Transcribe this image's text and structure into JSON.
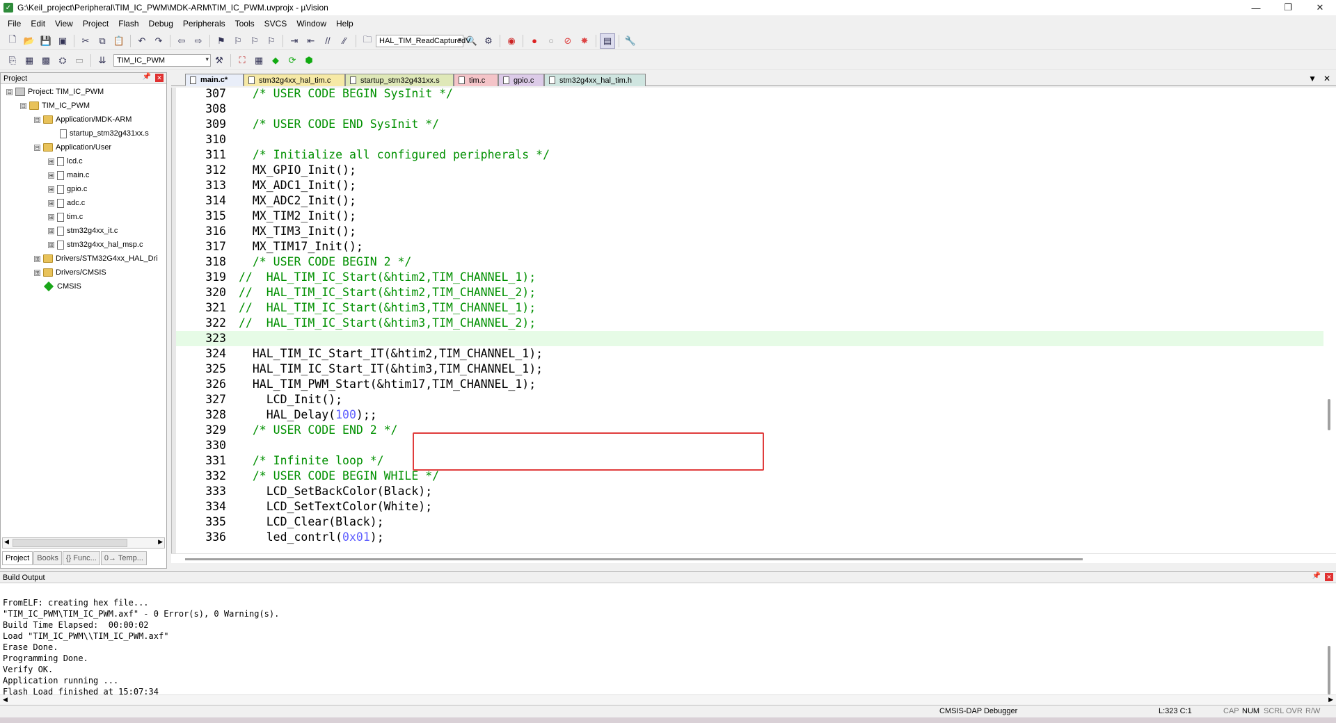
{
  "window": {
    "title": "G:\\Keil_project\\Peripheral\\TIM_IC_PWM\\MDK-ARM\\TIM_IC_PWM.uvprojx - µVision",
    "minimize": "—",
    "maximize": "❐",
    "close": "✕"
  },
  "menu": [
    "File",
    "Edit",
    "View",
    "Project",
    "Flash",
    "Debug",
    "Peripherals",
    "Tools",
    "SVCS",
    "Window",
    "Help"
  ],
  "toolbar": {
    "find_combo": "HAL_TIM_ReadCapturedV",
    "target_combo": "TIM_IC_PWM"
  },
  "project_pane": {
    "title": "Project",
    "tree": [
      {
        "label": "Project: TIM_IC_PWM",
        "icon": "project-icon",
        "expander": "⊟"
      },
      {
        "label": "TIM_IC_PWM",
        "icon": "folder-icon",
        "expander": "⊟"
      },
      {
        "label": "Application/MDK-ARM",
        "icon": "folder-icon",
        "expander": "⊟"
      },
      {
        "label": "startup_stm32g431xx.s",
        "icon": "file-icon",
        "expander": ""
      },
      {
        "label": "Application/User",
        "icon": "folder-icon",
        "expander": "⊟"
      },
      {
        "label": "lcd.c",
        "icon": "file-icon",
        "expander": "⊞"
      },
      {
        "label": "main.c",
        "icon": "file-icon",
        "expander": "⊞"
      },
      {
        "label": "gpio.c",
        "icon": "file-icon",
        "expander": "⊞"
      },
      {
        "label": "adc.c",
        "icon": "file-icon",
        "expander": "⊞"
      },
      {
        "label": "tim.c",
        "icon": "file-icon",
        "expander": "⊞"
      },
      {
        "label": "stm32g4xx_it.c",
        "icon": "file-icon",
        "expander": "⊞"
      },
      {
        "label": "stm32g4xx_hal_msp.c",
        "icon": "file-icon",
        "expander": "⊞"
      },
      {
        "label": "Drivers/STM32G4xx_HAL_Dri",
        "icon": "folder-icon",
        "expander": "⊞"
      },
      {
        "label": "Drivers/CMSIS",
        "icon": "folder-icon",
        "expander": "⊞"
      },
      {
        "label": "CMSIS",
        "icon": "diamond-icon",
        "expander": ""
      }
    ],
    "tabs": [
      "Project",
      "Books",
      "{} Func...",
      "0→ Temp..."
    ]
  },
  "file_tabs": [
    {
      "label": "main.c*",
      "color": "#e9eef9"
    },
    {
      "label": "stm32g4xx_hal_tim.c",
      "color": "#f6e9a6"
    },
    {
      "label": "startup_stm32g431xx.s",
      "color": "#dfe8b8"
    },
    {
      "label": "tim.c",
      "color": "#f4c4c8"
    },
    {
      "label": "gpio.c",
      "color": "#dccbe8"
    },
    {
      "label": "stm32g4xx_hal_tim.h",
      "color": "#cfe5e0"
    }
  ],
  "code": [
    {
      "n": "307",
      "t": "  /* USER CODE BEGIN SysInit */",
      "k": "cm"
    },
    {
      "n": "308",
      "t": "",
      "k": ""
    },
    {
      "n": "309",
      "t": "  /* USER CODE END SysInit */",
      "k": "cm"
    },
    {
      "n": "310",
      "t": "",
      "k": ""
    },
    {
      "n": "311",
      "t": "  /* Initialize all configured peripherals */",
      "k": "cm"
    },
    {
      "n": "312",
      "t": "  MX_GPIO_Init();",
      "k": ""
    },
    {
      "n": "313",
      "t": "  MX_ADC1_Init();",
      "k": ""
    },
    {
      "n": "314",
      "t": "  MX_ADC2_Init();",
      "k": ""
    },
    {
      "n": "315",
      "t": "  MX_TIM2_Init();",
      "k": ""
    },
    {
      "n": "316",
      "t": "  MX_TIM3_Init();",
      "k": ""
    },
    {
      "n": "317",
      "t": "  MX_TIM17_Init();",
      "k": ""
    },
    {
      "n": "318",
      "t": "  /* USER CODE BEGIN 2 */",
      "k": "cm"
    },
    {
      "n": "319",
      "t": "//  HAL_TIM_IC_Start(&htim2,TIM_CHANNEL_1);",
      "k": "cm"
    },
    {
      "n": "320",
      "t": "//  HAL_TIM_IC_Start(&htim2,TIM_CHANNEL_2);",
      "k": "cm"
    },
    {
      "n": "321",
      "t": "//  HAL_TIM_IC_Start(&htim3,TIM_CHANNEL_1);",
      "k": "cm"
    },
    {
      "n": "322",
      "t": "//  HAL_TIM_IC_Start(&htim3,TIM_CHANNEL_2);",
      "k": "cm"
    },
    {
      "n": "323",
      "t": "",
      "k": "cur"
    },
    {
      "n": "324",
      "t": "  HAL_TIM_IC_Start_IT(&htim2,TIM_CHANNEL_1);",
      "k": ""
    },
    {
      "n": "325",
      "t": "  HAL_TIM_IC_Start_IT(&htim3,TIM_CHANNEL_1);",
      "k": ""
    },
    {
      "n": "326",
      "t": "  HAL_TIM_PWM_Start(&htim17,TIM_CHANNEL_1);",
      "k": ""
    },
    {
      "n": "327",
      "t": "    LCD_Init();",
      "k": ""
    },
    {
      "n": "328",
      "t": "    HAL_Delay(",
      "k": "",
      "num": "100",
      "after": ");;"
    },
    {
      "n": "329",
      "t": "  /* USER CODE END 2 */",
      "k": "cm"
    },
    {
      "n": "330",
      "t": "",
      "k": ""
    },
    {
      "n": "331",
      "t": "  /* Infinite loop */",
      "k": "cm"
    },
    {
      "n": "332",
      "t": "  /* USER CODE BEGIN WHILE */",
      "k": "cm"
    },
    {
      "n": "333",
      "t": "    LCD_SetBackColor(Black);",
      "k": ""
    },
    {
      "n": "334",
      "t": "    LCD_SetTextColor(White);",
      "k": ""
    },
    {
      "n": "335",
      "t": "    LCD_Clear(Black);",
      "k": ""
    },
    {
      "n": "336",
      "t": "    led_contrl(",
      "k": "",
      "num": "0x01",
      "after": ");"
    }
  ],
  "build_output": {
    "title": "Build Output",
    "lines": [
      "FromELF: creating hex file...",
      "\"TIM_IC_PWM\\TIM_IC_PWM.axf\" - 0 Error(s), 0 Warning(s).",
      "Build Time Elapsed:  00:00:02",
      "Load \"TIM_IC_PWM\\\\TIM_IC_PWM.axf\"",
      "Erase Done.",
      "Programming Done.",
      "Verify OK.",
      "Application running ...",
      "Flash Load finished at 15:07:34"
    ]
  },
  "status": {
    "debugger": "CMSIS-DAP Debugger",
    "position": "L:323 C:1",
    "cap": "CAP",
    "num": "NUM",
    "scrl": "SCRL",
    "ovr": "OVR",
    "rw": "R/W"
  }
}
